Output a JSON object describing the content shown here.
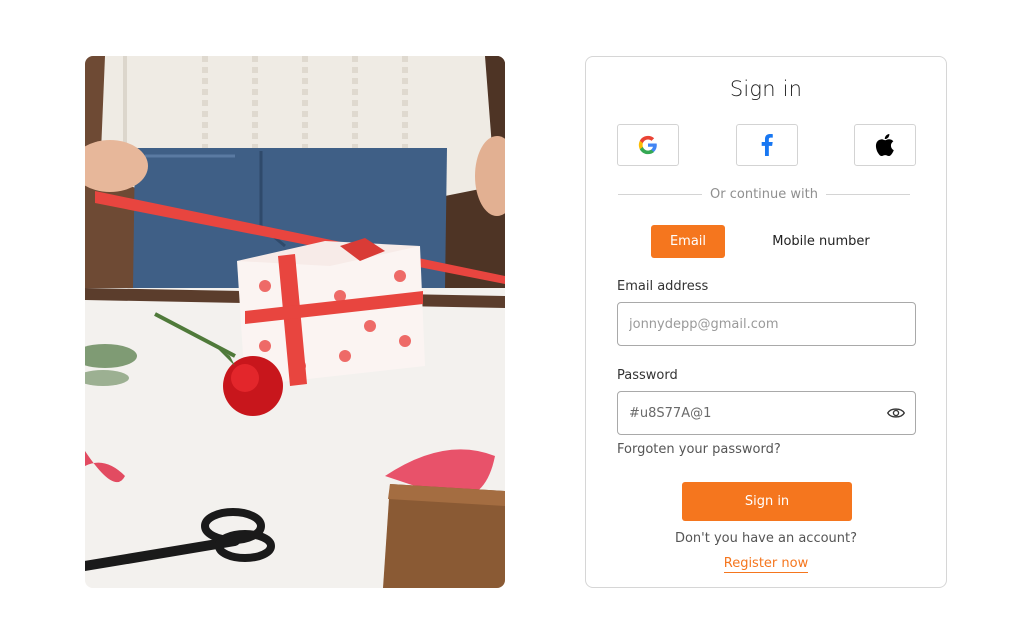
{
  "card": {
    "title": "Sign in",
    "social_buttons": [
      {
        "provider": "Google",
        "icon": "google-icon"
      },
      {
        "provider": "Facebook",
        "icon": "facebook-icon"
      },
      {
        "provider": "Apple",
        "icon": "apple-icon"
      }
    ],
    "divider_text": "Or continue with",
    "tabs": [
      {
        "label": "Email",
        "active": true
      },
      {
        "label": "Mobile number",
        "active": false
      }
    ],
    "email": {
      "label": "Email address",
      "placeholder": "jonnydepp@gmail.com",
      "value": ""
    },
    "password": {
      "label": "Password",
      "value": "#u8S77A@1",
      "toggle_icon": "eye-icon"
    },
    "forgot_text": "Forgoten your password?",
    "submit_label": "Sign in",
    "no_account_text": "Don't you have an account?",
    "register_text": "Register now"
  },
  "colors": {
    "accent": "#f5761e",
    "border": "#d6d6d6",
    "input_border": "#a9a9a9",
    "muted_text": "#8f8f8f"
  },
  "photo": {
    "description_icon": "gift-wrapping-photo"
  }
}
